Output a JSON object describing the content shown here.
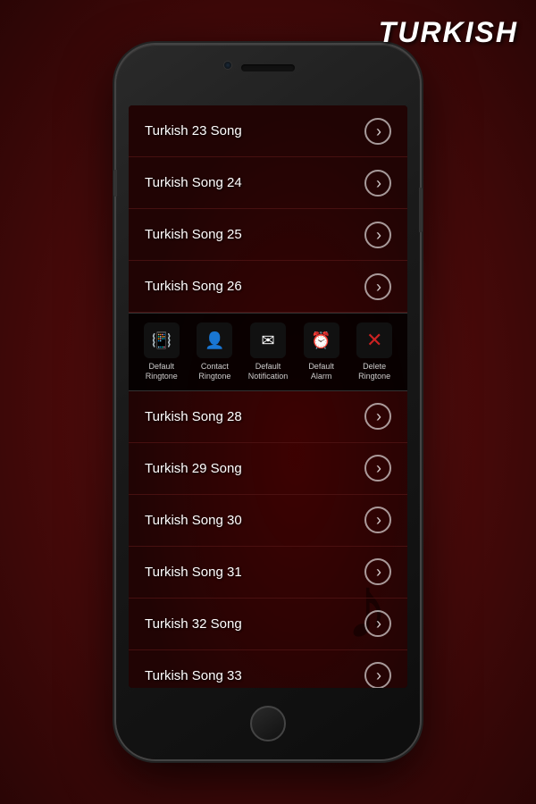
{
  "app": {
    "title": "TURKISH"
  },
  "songs": [
    {
      "id": 1,
      "name": "Turkish 23 Song"
    },
    {
      "id": 2,
      "name": "Turkish Song 24"
    },
    {
      "id": 3,
      "name": "Turkish Song 25"
    },
    {
      "id": 4,
      "name": "Turkish Song 26"
    },
    {
      "id": 5,
      "name": "Turkish Song 28"
    },
    {
      "id": 6,
      "name": "Turkish 29 Song"
    },
    {
      "id": 7,
      "name": "Turkish Song 30"
    },
    {
      "id": 8,
      "name": "Turkish Song 31"
    },
    {
      "id": 9,
      "name": "Turkish 32 Song"
    },
    {
      "id": 10,
      "name": "Turkish Song 33"
    }
  ],
  "popup": {
    "visible": true,
    "actions": [
      {
        "id": "default-ringtone",
        "icon": "📳",
        "label": "Default\nRingtone"
      },
      {
        "id": "contact-ringtone",
        "icon": "👤",
        "label": "Contact\nRingtone"
      },
      {
        "id": "default-notification",
        "icon": "✉",
        "label": "Default\nNotification"
      },
      {
        "id": "default-alarm",
        "icon": "⏰",
        "label": "Default\nAlarm"
      },
      {
        "id": "delete-ringtone",
        "icon": "✕",
        "label": "Delete\nRingtone"
      }
    ]
  }
}
